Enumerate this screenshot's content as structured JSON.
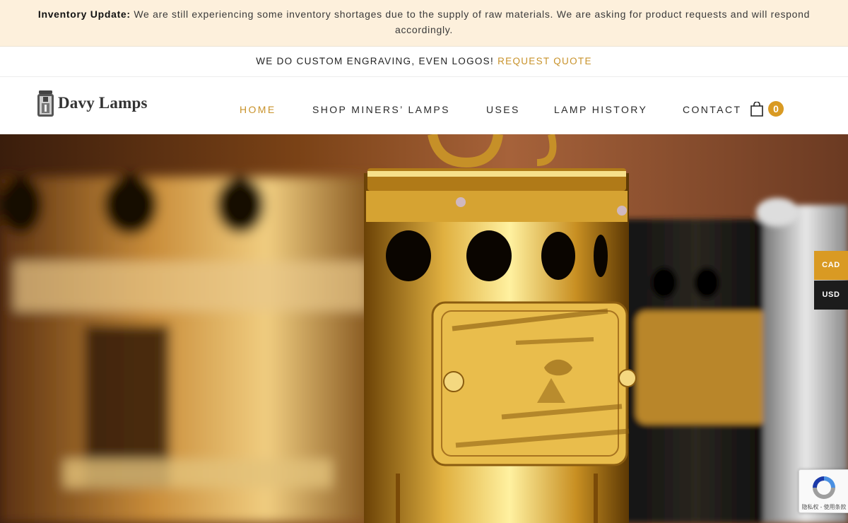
{
  "notice": {
    "label": "Inventory Update:",
    "text": "We are still experiencing some inventory shortages due to the supply of raw materials. We are asking for product requests and will respond accordingly."
  },
  "promo": {
    "text": "WE DO CUSTOM ENGRAVING, EVEN LOGOS!",
    "link": "REQUEST QUOTE"
  },
  "header": {
    "logo_text": "Davy Lamps",
    "nav": [
      {
        "label": "HOME",
        "active": true
      },
      {
        "label": "SHOP MINERS’ LAMPS",
        "active": false
      },
      {
        "label": "USES",
        "active": false
      },
      {
        "label": "LAMP HISTORY",
        "active": false
      },
      {
        "label": "CONTACT",
        "active": false
      }
    ],
    "cart_count": "0"
  },
  "currency": {
    "options": [
      "CAD",
      "USD"
    ],
    "selected": "CAD"
  },
  "recaptcha": {
    "terms": "隐私权 - 使用条款"
  },
  "colors": {
    "accent": "#d99a23",
    "nav_active": "#c8922a",
    "notice_bg": "#fdf0dc",
    "dark": "#1c1c1c"
  },
  "icons": [
    "lamp-logo-icon",
    "shopping-bag-icon",
    "recaptcha-icon"
  ]
}
